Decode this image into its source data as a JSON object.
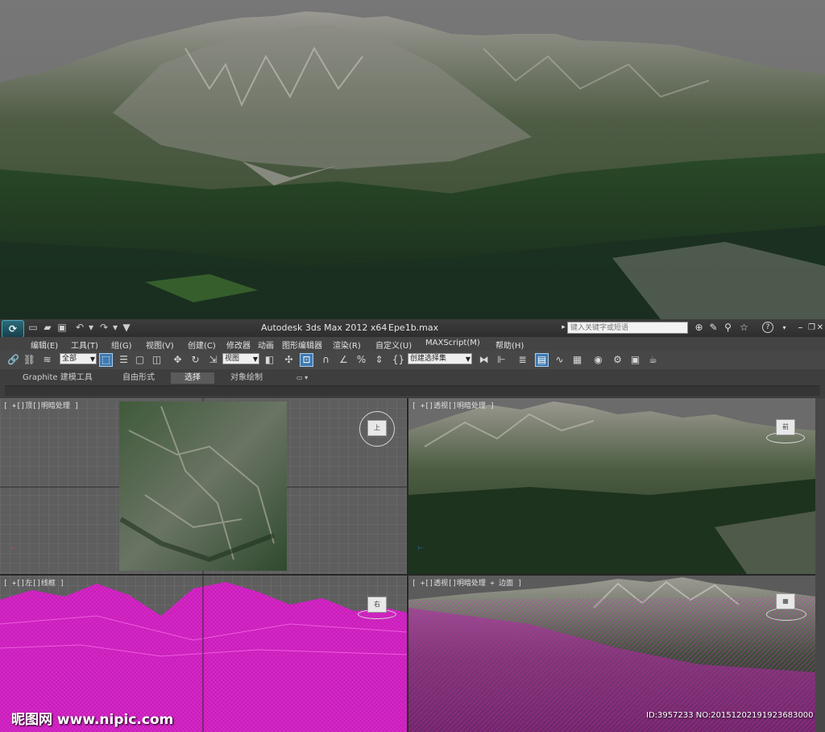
{
  "titlebar": {
    "app_title": "Autodesk 3ds Max  2012 x64",
    "file_name": "Epe1b.max",
    "search_placeholder": "键入关键字或短语",
    "help": "?"
  },
  "menu": [
    "编辑(E)",
    "工具(T)",
    "组(G)",
    "视图(V)",
    "创建(C)",
    "修改器",
    "动画",
    "图形编辑器",
    "渲染(R)",
    "自定义(U)",
    "MAXScript(M)",
    "帮助(H)"
  ],
  "toolbar": {
    "selection_filter": "全部",
    "reference_coord": "视图",
    "named_selection": "创建选择集"
  },
  "ribbon": {
    "tabs": [
      "Graphite 建模工具",
      "自由形式",
      "选择",
      "对象绘制"
    ],
    "active_tab": "选择"
  },
  "viewports": {
    "top": {
      "label": "[ +[]顶[]明暗处理 ]",
      "cube_label": "上"
    },
    "persp1": {
      "label": "[ +[]透视[]明暗处理 ]",
      "cube_label": "前"
    },
    "left": {
      "label": "[ +[]左[]线框 ]",
      "cube_label": "右"
    },
    "persp2": {
      "label": "[ +[]透视[]明暗处理 + 边面 ]",
      "cube_label": ""
    }
  },
  "watermark": {
    "site": "昵图网 www.nipic.com",
    "id": "ID:3957233 NO:20151202191923683000"
  },
  "colors": {
    "wireframe": "#cc22bb",
    "active_viewport": "#c9b84a",
    "ui_dark": "#444444"
  }
}
